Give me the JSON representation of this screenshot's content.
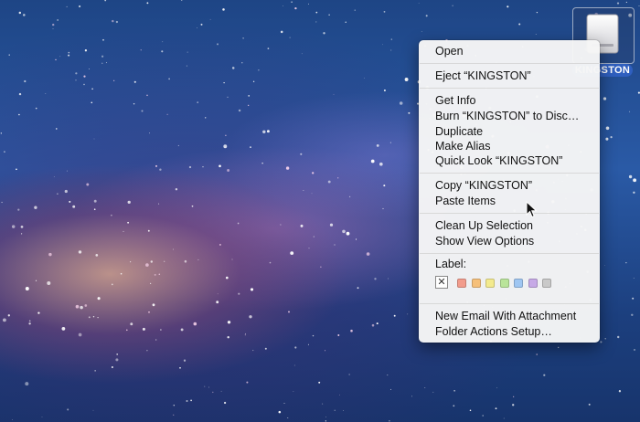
{
  "desktop": {
    "drive": {
      "name": "KINGSTON",
      "icon": "external-drive-icon"
    }
  },
  "menu": {
    "groups": [
      [
        "Open"
      ],
      [
        "Eject “KINGSTON”"
      ],
      [
        "Get Info",
        "Burn “KINGSTON” to Disc…",
        "Duplicate",
        "Make Alias",
        "Quick Look “KINGSTON”"
      ],
      [
        "Copy “KINGSTON”",
        "Paste Items"
      ],
      [
        "Clean Up Selection",
        "Show View Options"
      ]
    ],
    "label_title": "Label:",
    "label_colors": [
      "#f29c8c",
      "#f6c07a",
      "#f3ea8e",
      "#b9e49a",
      "#9fc6f2",
      "#c6a9e6",
      "#c9c9c9"
    ],
    "bottom": [
      "New Email With Attachment",
      "Folder Actions Setup…"
    ]
  }
}
